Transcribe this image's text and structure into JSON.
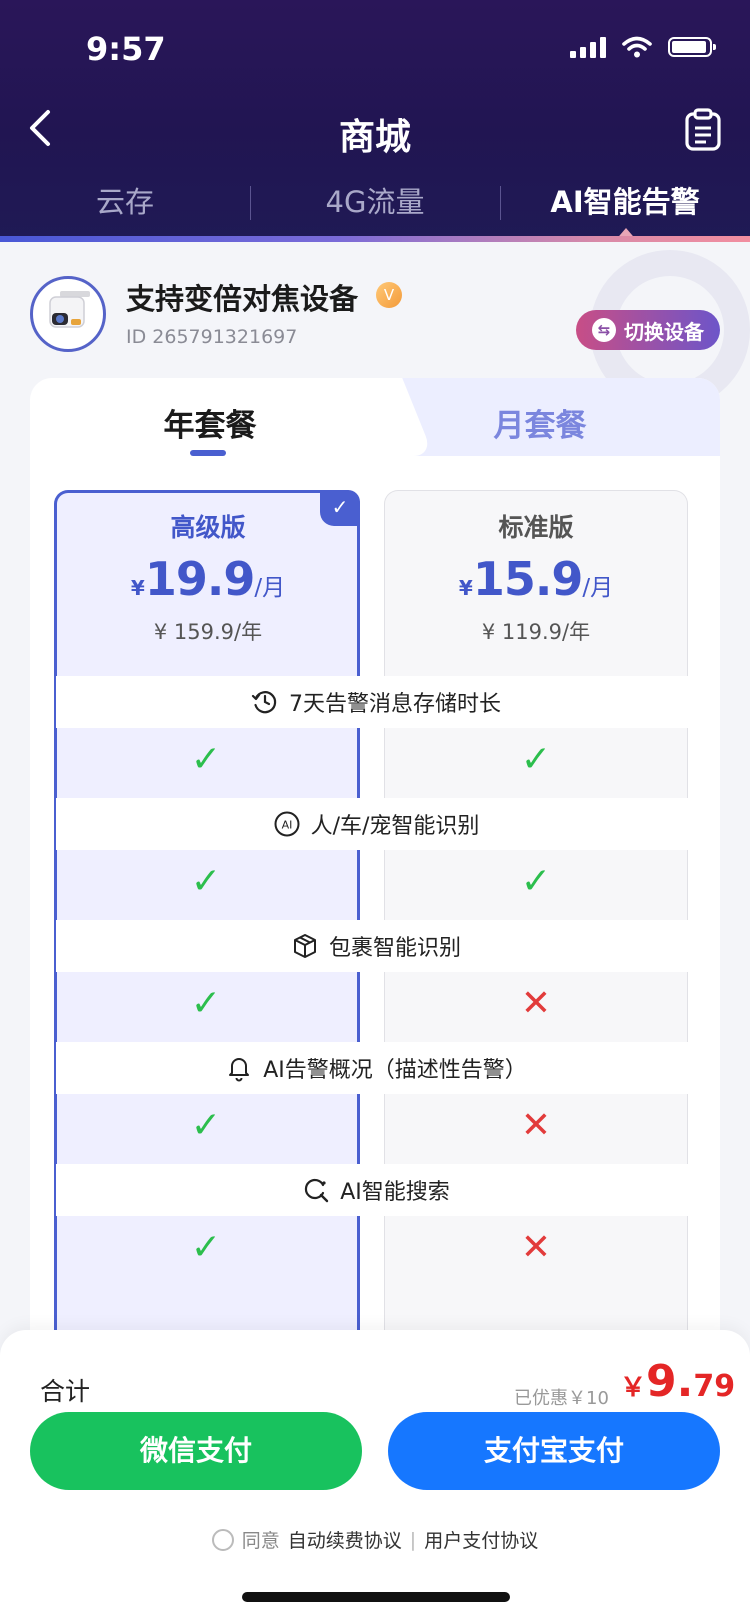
{
  "status": {
    "time": "9:57"
  },
  "header": {
    "title": "商城",
    "tabs": [
      {
        "label": "云存"
      },
      {
        "label": "4G流量"
      },
      {
        "label": "AI智能告警",
        "active": true
      }
    ]
  },
  "device": {
    "name": "支持变倍对焦设备",
    "id_text": "ID 265791321697",
    "verified_mark": "V",
    "switch_label": "切换设备"
  },
  "period_tabs": {
    "year": "年套餐",
    "month": "月套餐",
    "active": "year"
  },
  "plans": [
    {
      "name": "高级版",
      "currency": "¥",
      "price": "19.9",
      "per": "/月",
      "yearly": "¥ 159.9/年",
      "selected": true,
      "name_color": "#4257c9"
    },
    {
      "name": "标准版",
      "currency": "¥",
      "price": "15.9",
      "per": "/月",
      "yearly": "¥ 119.9/年",
      "selected": false,
      "name_color": "#555555"
    }
  ],
  "features": [
    {
      "label": "7天告警消息存储时长",
      "icon": "history-clock-icon",
      "premium": true,
      "standard": true
    },
    {
      "label": "人/车/宠智能识别",
      "icon": "ai-circle-icon",
      "premium": true,
      "standard": true
    },
    {
      "label": "包裹智能识别",
      "icon": "package-box-icon",
      "premium": true,
      "standard": false
    },
    {
      "label": "AI告警概况（描述性告警）",
      "icon": "bell-icon",
      "premium": true,
      "standard": false
    },
    {
      "label": "AI智能搜索",
      "icon": "ai-search-icon",
      "premium": true,
      "standard": false
    }
  ],
  "checkout": {
    "total_label": "合计",
    "saved_text": "已优惠￥10",
    "currency": "￥",
    "total_int": "9.",
    "total_dec": "79",
    "wechat_label": "微信支付",
    "alipay_label": "支付宝支付",
    "agree_text": "同意",
    "agreement_1": "自动续费协议",
    "agreement_sep": "|",
    "agreement_2": "用户支付协议"
  },
  "colors": {
    "accent": "#4a5fd0",
    "price": "#4257c9",
    "check": "#2cbe4d",
    "cross": "#e23b3b",
    "total": "#e42626",
    "wechat": "#18c25e",
    "alipay": "#1677ff"
  }
}
